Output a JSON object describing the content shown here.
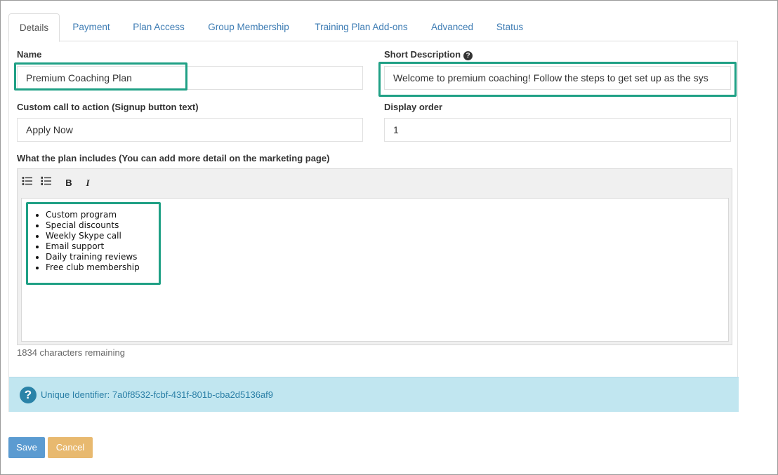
{
  "tabs": [
    {
      "label": "Details"
    },
    {
      "label": "Payment"
    },
    {
      "label": "Plan Access"
    },
    {
      "label": "Group Membership"
    },
    {
      "label": "Training Plan Add-ons"
    },
    {
      "label": "Advanced"
    },
    {
      "label": "Status"
    }
  ],
  "active_tab": "Details",
  "form": {
    "name": {
      "label": "Name",
      "value": "Premium Coaching Plan"
    },
    "short_description": {
      "label": "Short Description",
      "value": "Welcome to premium coaching! Follow the steps to get set up as the sys"
    },
    "cta": {
      "label": "Custom call to action (Signup button text)",
      "value": "Apply Now"
    },
    "display_order": {
      "label": "Display order",
      "value": "1"
    },
    "includes": {
      "label": "What the plan includes (You can add more detail on the marketing page)",
      "toolbar": {
        "bulleted": "☰",
        "numbered": "☷",
        "bold": "B",
        "italic": "I"
      },
      "items": [
        "Custom program",
        "Special discounts",
        "Weekly Skype call",
        "Email support",
        "Daily training reviews",
        "Free club membership"
      ],
      "remaining": "1834 characters remaining"
    }
  },
  "info": {
    "icon": "question-icon",
    "icon_glyph": "?",
    "text": "Unique Identifier: 7a0f8532-fcbf-431f-801b-cba2d5136af9"
  },
  "buttons": {
    "save": "Save",
    "cancel": "Cancel"
  },
  "colors": {
    "highlight": "#1fa085",
    "link": "#3c7bb3",
    "save": "#5b9bd1",
    "cancel": "#e8b96f",
    "info_bg": "#c1e6f0"
  }
}
